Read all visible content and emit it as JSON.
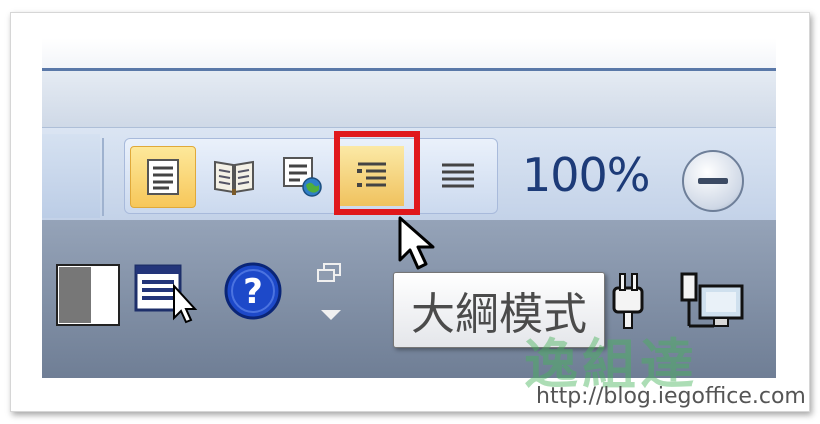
{
  "view_buttons": [
    {
      "name": "print-layout",
      "icon": "page-lines-icon",
      "active": true
    },
    {
      "name": "full-screen-reading",
      "icon": "open-book-icon",
      "active": false
    },
    {
      "name": "web-layout",
      "icon": "web-page-globe-icon",
      "active": false
    },
    {
      "name": "outline",
      "icon": "outline-list-icon",
      "active": false,
      "highlighted": true
    },
    {
      "name": "draft",
      "icon": "horizontal-lines-icon",
      "active": false
    }
  ],
  "zoom": {
    "level": "100%"
  },
  "tooltip": {
    "text": "大綱模式"
  },
  "watermark": {
    "text": "逸組達",
    "url": "http://blog.iegoffice.com"
  },
  "colors": {
    "highlight_border": "#e0181c",
    "active_button": "#f7c75a",
    "statusbar": "#c3d2e8",
    "zoom_text": "#1d3b78"
  }
}
